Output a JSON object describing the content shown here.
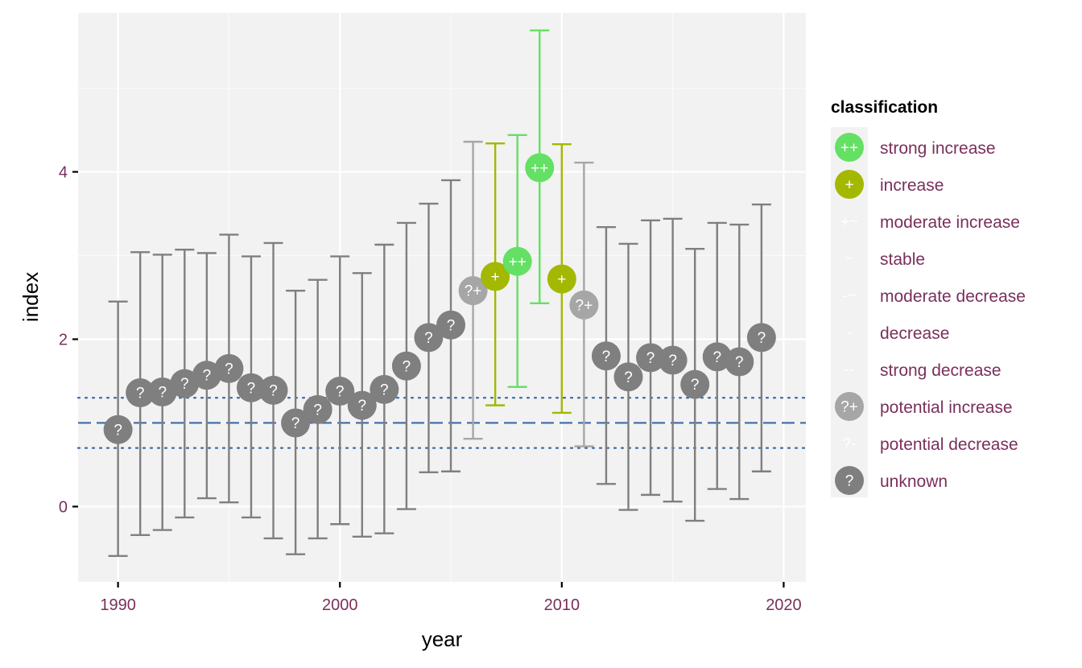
{
  "chart_data": {
    "type": "scatter",
    "subtype": "point-with-errorbars",
    "title": "",
    "xlabel": "year",
    "ylabel": "index",
    "xlim": [
      1988.2,
      2021.0
    ],
    "ylim": [
      -0.9,
      5.9
    ],
    "x_ticks": [
      1990,
      2000,
      2010,
      2020
    ],
    "y_ticks": [
      0,
      2,
      4
    ],
    "grid": true,
    "reference_lines": [
      {
        "value": 1.0,
        "style": "dashed",
        "color": "#3a6aa5"
      },
      {
        "value": 1.3,
        "style": "dotted",
        "color": "#3a6aa5"
      },
      {
        "value": 0.7,
        "style": "dotted",
        "color": "#3a6aa5"
      }
    ],
    "legend": {
      "title": "classification",
      "position": "right",
      "entries": [
        {
          "key": "strong_increase",
          "label": "strong increase",
          "symbol": "++",
          "color": "#64e064",
          "filled": true
        },
        {
          "key": "increase",
          "label": "increase",
          "symbol": "+",
          "color": "#a3b800",
          "filled": true
        },
        {
          "key": "moderate_increase",
          "label": "moderate increase",
          "symbol": "+~",
          "color": "",
          "filled": false
        },
        {
          "key": "stable",
          "label": "stable",
          "symbol": "~",
          "color": "",
          "filled": false
        },
        {
          "key": "moderate_decrease",
          "label": "moderate decrease",
          "symbol": "-~",
          "color": "",
          "filled": false
        },
        {
          "key": "decrease",
          "label": "decrease",
          "symbol": "-",
          "color": "",
          "filled": false
        },
        {
          "key": "strong_decrease",
          "label": "strong decrease",
          "symbol": "--",
          "color": "",
          "filled": false
        },
        {
          "key": "potential_increase",
          "label": "potential increase",
          "symbol": "?+",
          "color": "#a6a6a6",
          "filled": true
        },
        {
          "key": "potential_decrease",
          "label": "potential decrease",
          "symbol": "?-",
          "color": "",
          "filled": false
        },
        {
          "key": "unknown",
          "label": "unknown",
          "symbol": "?",
          "color": "#7f7f7f",
          "filled": true
        }
      ]
    },
    "points": [
      {
        "year": 1990,
        "index": 0.92,
        "lower": -0.59,
        "upper": 2.45,
        "class": "unknown"
      },
      {
        "year": 1991,
        "index": 1.36,
        "lower": -0.34,
        "upper": 3.04,
        "class": "unknown"
      },
      {
        "year": 1992,
        "index": 1.37,
        "lower": -0.28,
        "upper": 3.01,
        "class": "unknown"
      },
      {
        "year": 1993,
        "index": 1.47,
        "lower": -0.13,
        "upper": 3.07,
        "class": "unknown"
      },
      {
        "year": 1994,
        "index": 1.57,
        "lower": 0.1,
        "upper": 3.03,
        "class": "unknown"
      },
      {
        "year": 1995,
        "index": 1.65,
        "lower": 0.05,
        "upper": 3.25,
        "class": "unknown"
      },
      {
        "year": 1996,
        "index": 1.42,
        "lower": -0.13,
        "upper": 2.99,
        "class": "unknown"
      },
      {
        "year": 1997,
        "index": 1.39,
        "lower": -0.38,
        "upper": 3.15,
        "class": "unknown"
      },
      {
        "year": 1998,
        "index": 1.0,
        "lower": -0.57,
        "upper": 2.58,
        "class": "unknown"
      },
      {
        "year": 1999,
        "index": 1.16,
        "lower": -0.38,
        "upper": 2.71,
        "class": "unknown"
      },
      {
        "year": 2000,
        "index": 1.38,
        "lower": -0.21,
        "upper": 2.99,
        "class": "unknown"
      },
      {
        "year": 2001,
        "index": 1.21,
        "lower": -0.36,
        "upper": 2.79,
        "class": "unknown"
      },
      {
        "year": 2002,
        "index": 1.4,
        "lower": -0.32,
        "upper": 3.13,
        "class": "unknown"
      },
      {
        "year": 2003,
        "index": 1.68,
        "lower": -0.03,
        "upper": 3.39,
        "class": "unknown"
      },
      {
        "year": 2004,
        "index": 2.02,
        "lower": 0.41,
        "upper": 3.62,
        "class": "unknown"
      },
      {
        "year": 2005,
        "index": 2.17,
        "lower": 0.42,
        "upper": 3.9,
        "class": "unknown"
      },
      {
        "year": 2006,
        "index": 2.58,
        "lower": 0.81,
        "upper": 4.36,
        "class": "potential_increase"
      },
      {
        "year": 2007,
        "index": 2.75,
        "lower": 1.21,
        "upper": 4.34,
        "class": "increase"
      },
      {
        "year": 2008,
        "index": 2.93,
        "lower": 1.43,
        "upper": 4.44,
        "class": "strong_increase"
      },
      {
        "year": 2009,
        "index": 4.05,
        "lower": 2.43,
        "upper": 5.69,
        "class": "strong_increase"
      },
      {
        "year": 2010,
        "index": 2.72,
        "lower": 1.12,
        "upper": 4.33,
        "class": "increase"
      },
      {
        "year": 2011,
        "index": 2.41,
        "lower": 0.72,
        "upper": 4.11,
        "class": "potential_increase"
      },
      {
        "year": 2012,
        "index": 1.8,
        "lower": 0.27,
        "upper": 3.34,
        "class": "unknown"
      },
      {
        "year": 2013,
        "index": 1.55,
        "lower": -0.04,
        "upper": 3.14,
        "class": "unknown"
      },
      {
        "year": 2014,
        "index": 1.78,
        "lower": 0.14,
        "upper": 3.42,
        "class": "unknown"
      },
      {
        "year": 2015,
        "index": 1.75,
        "lower": 0.06,
        "upper": 3.44,
        "class": "unknown"
      },
      {
        "year": 2016,
        "index": 1.46,
        "lower": -0.17,
        "upper": 3.08,
        "class": "unknown"
      },
      {
        "year": 2017,
        "index": 1.79,
        "lower": 0.21,
        "upper": 3.39,
        "class": "unknown"
      },
      {
        "year": 2018,
        "index": 1.73,
        "lower": 0.09,
        "upper": 3.37,
        "class": "unknown"
      },
      {
        "year": 2019,
        "index": 2.02,
        "lower": 0.42,
        "upper": 3.61,
        "class": "unknown"
      }
    ]
  }
}
